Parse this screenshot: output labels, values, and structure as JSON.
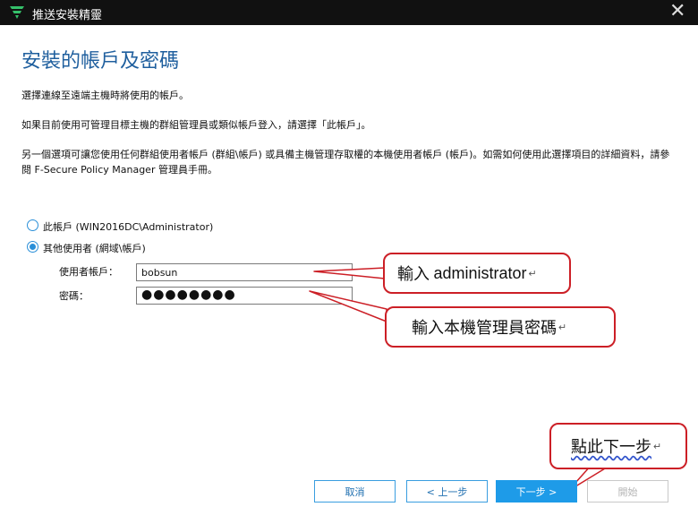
{
  "window": {
    "title": "推送安裝精靈",
    "close_glyph": "✕"
  },
  "page": {
    "heading": "安裝的帳戶及密碼",
    "paragraphs": [
      "選擇連線至遠端主機時將使用的帳戶。",
      "如果目前使用可管理目標主機的群組管理員或類似帳戶登入，請選擇「此帳戶」。",
      "另一個選項可讓您使用任何群組使用者帳戶 (群組\\帳戶) 或具備主機管理存取權的本機使用者帳戶 (帳戶)。如需如何使用此選擇項目的詳細資料，請參閱 F-Secure Policy Manager 管理員手冊。"
    ]
  },
  "options": {
    "this_account": {
      "label": "此帳戶 (WIN2016DC\\Administrator)",
      "checked": false
    },
    "other_user": {
      "label": "其他使用者 (網域\\帳戶)",
      "checked": true
    }
  },
  "form": {
    "account_label": "使用者帳戶：",
    "account_value": "bobsun",
    "password_label": "密碼：",
    "password_value": "●●●●●●●●"
  },
  "callouts": {
    "account_pre": "輸入",
    "account_word": "administrator",
    "password": "輸入本機管理員密碼",
    "next": "點此下一步",
    "return_mark": "↵"
  },
  "buttons": {
    "cancel": "取消",
    "back": "< 上一步",
    "next": "下一步 >",
    "finish": "開始"
  },
  "colors": {
    "title_bar": "#111111",
    "heading": "#1f5f9e",
    "accent": "#1e9be8",
    "callout_border": "#cc1f26"
  }
}
